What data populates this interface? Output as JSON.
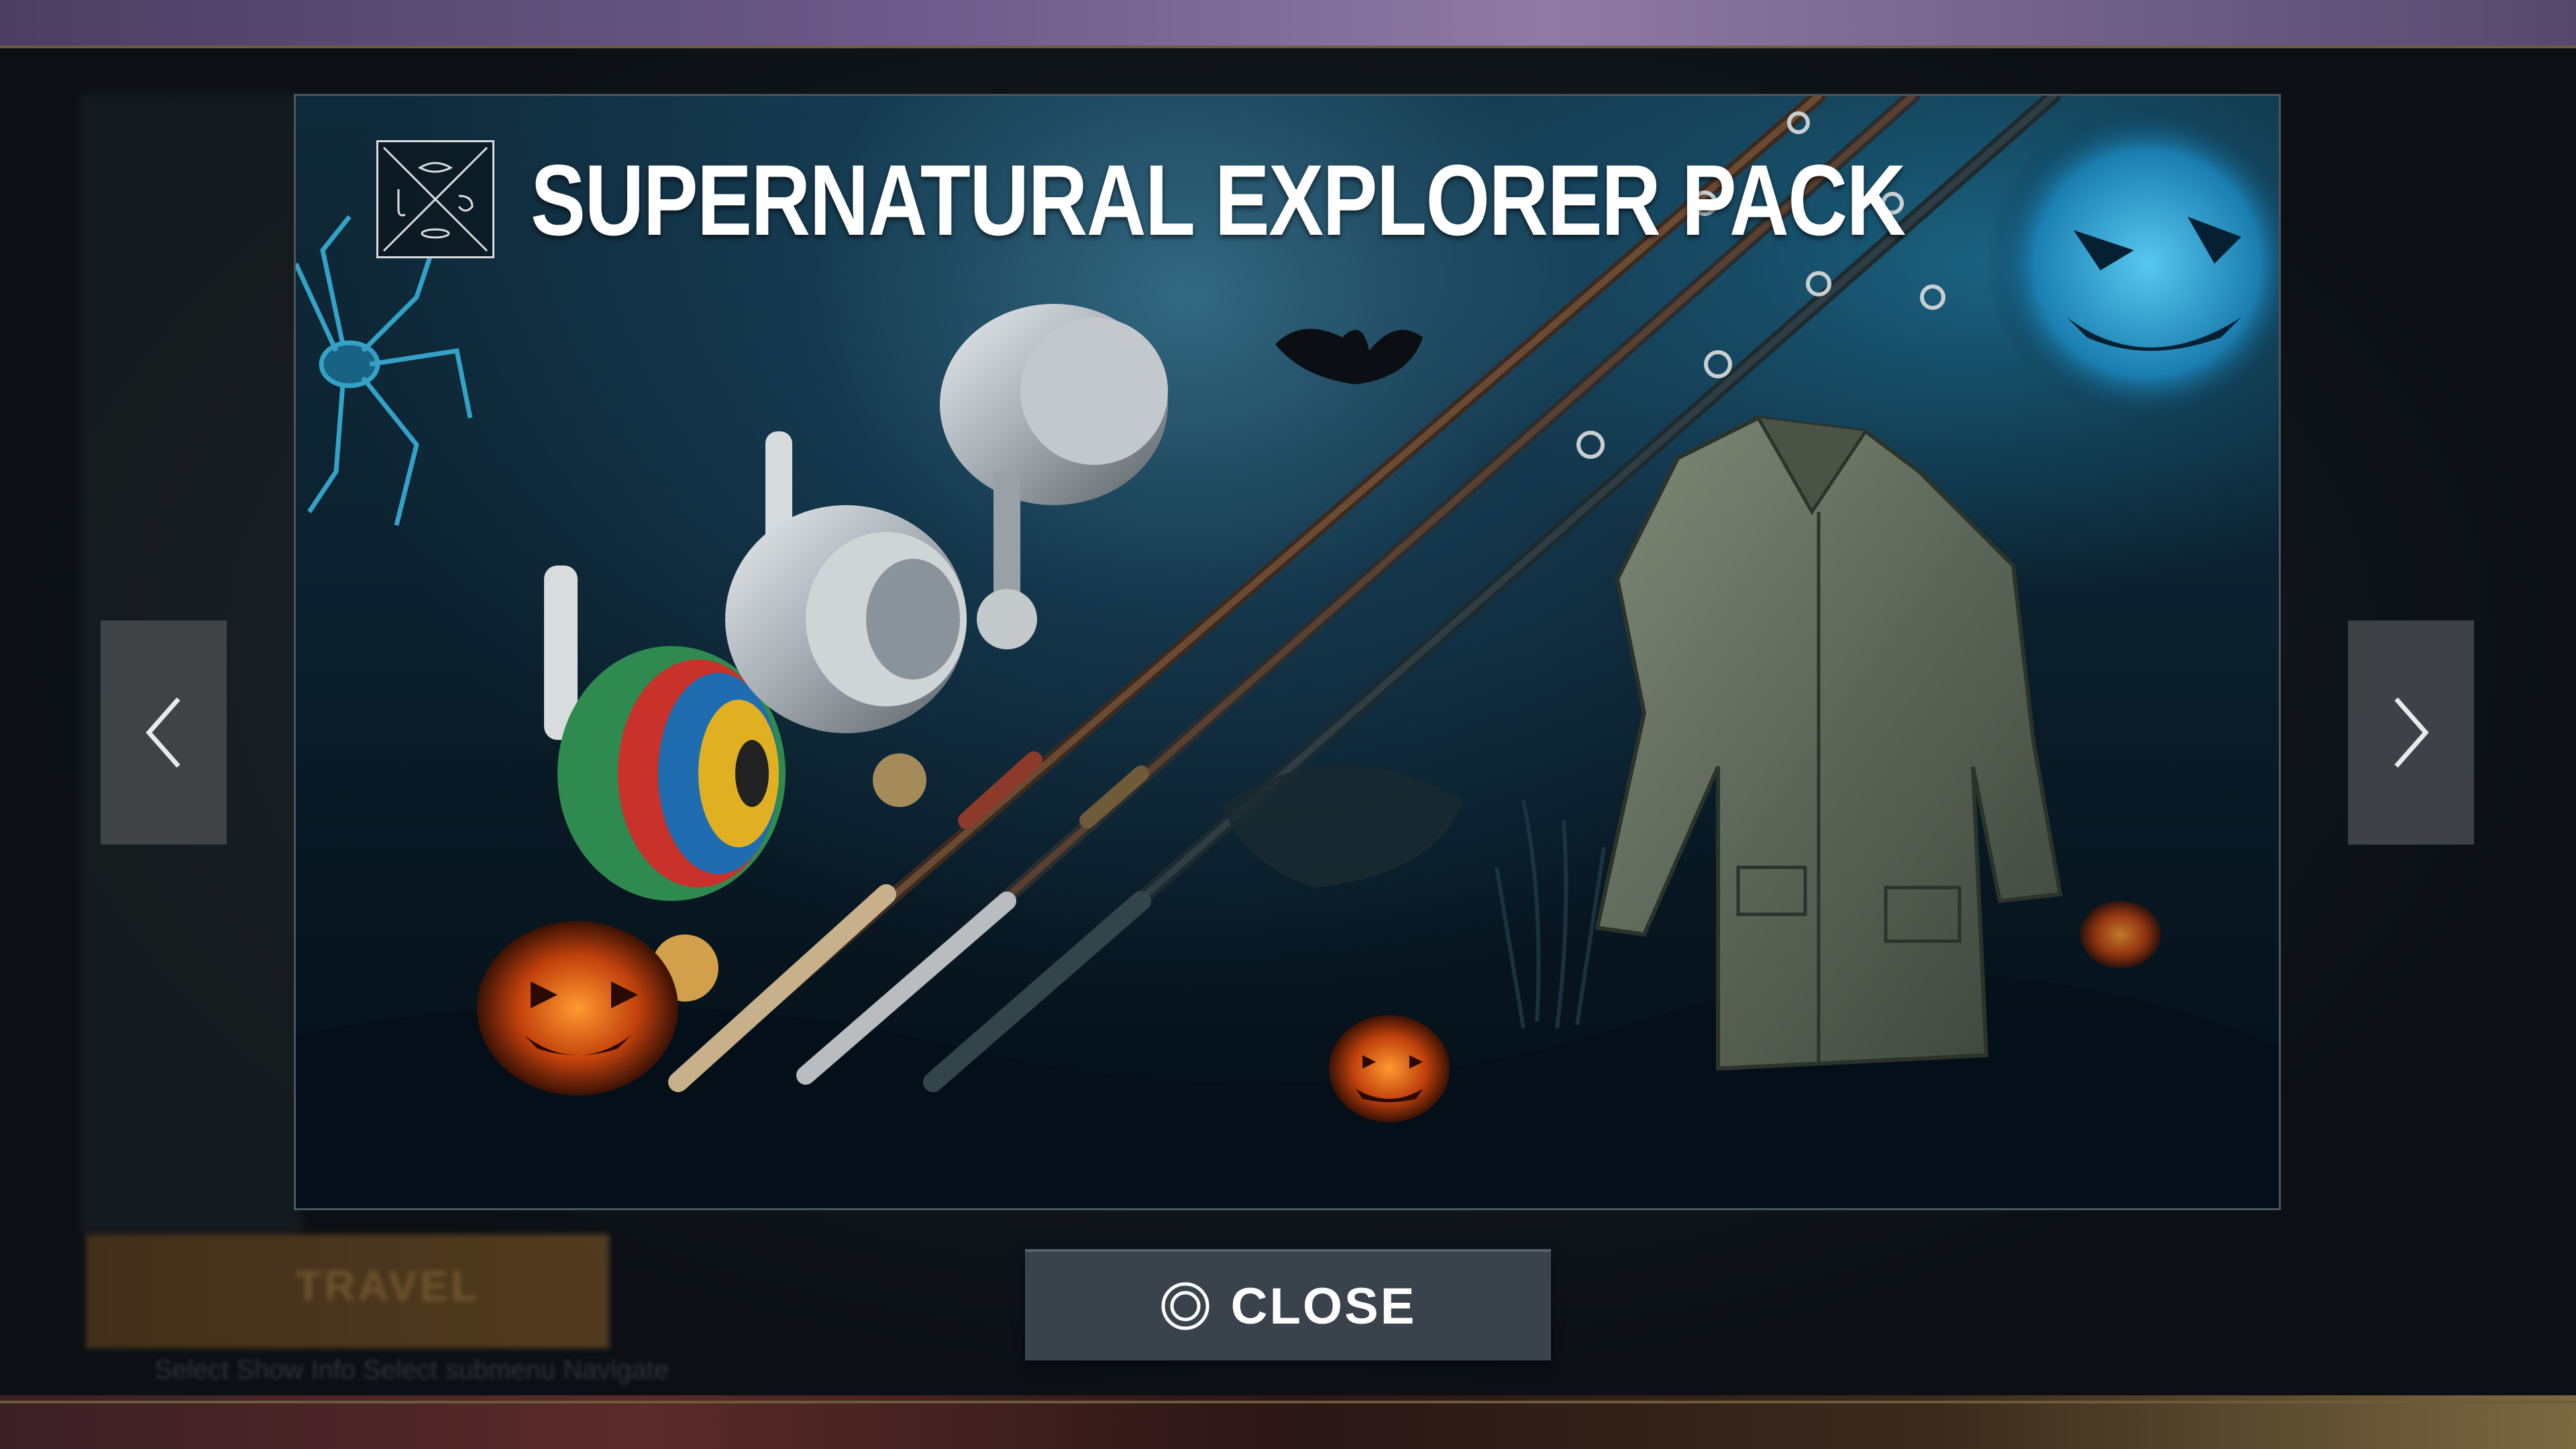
{
  "modal": {
    "title": "SUPERNATURAL EXPLORER PACK",
    "close_label": "CLOSE"
  },
  "background": {
    "travel_label": "TRAVEL",
    "footer_hint": "Select   Show Info   Select submenu   Navigate"
  },
  "icons": {
    "prev": "chevron-left-icon",
    "next": "chevron-right-icon",
    "close": "circle-button-icon",
    "logo": "fishing-logo-icon"
  },
  "colors": {
    "button_bg": "#3a434b",
    "nav_bg": "#464a4e",
    "text": "#ffffff",
    "accent_glow": "#2fb4e8",
    "pumpkin": "#e06a1a"
  }
}
